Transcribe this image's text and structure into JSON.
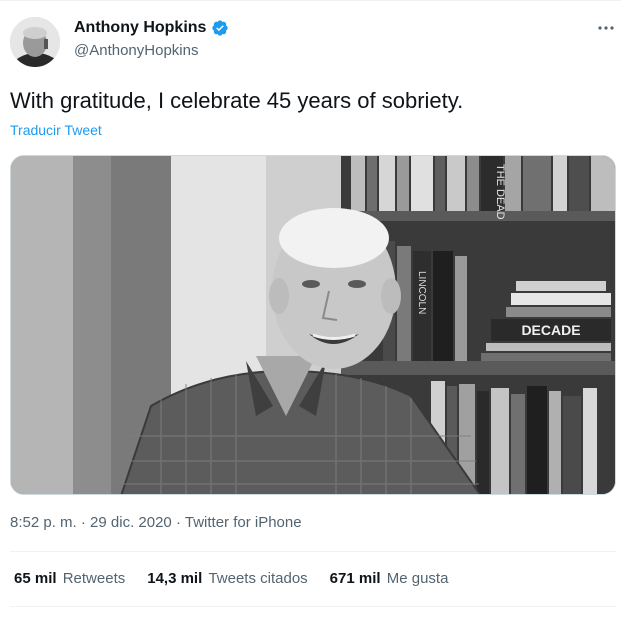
{
  "author": {
    "name": "Anthony Hopkins",
    "handle": "@AnthonyHopkins"
  },
  "tweet": {
    "text": "With gratitude, I celebrate 45 years of sobriety.",
    "translate_label": "Traducir Tweet",
    "time": "8:52 p. m.",
    "date": "29 dic. 2020",
    "source": "Twitter for iPhone",
    "separator": "·"
  },
  "media": {
    "spine_texts": [
      "THE DEAD",
      "LINCOLN",
      "DECADE"
    ]
  },
  "stats": [
    {
      "count": "65 mil",
      "label": "Retweets"
    },
    {
      "count": "14,3 mil",
      "label": "Tweets citados"
    },
    {
      "count": "671 mil",
      "label": "Me gusta"
    }
  ],
  "colors": {
    "link": "#1d9bf0",
    "secondary_text": "#536471",
    "primary_text": "#0f1419"
  },
  "icons": [
    "verified-badge-icon",
    "more-options-icon"
  ]
}
